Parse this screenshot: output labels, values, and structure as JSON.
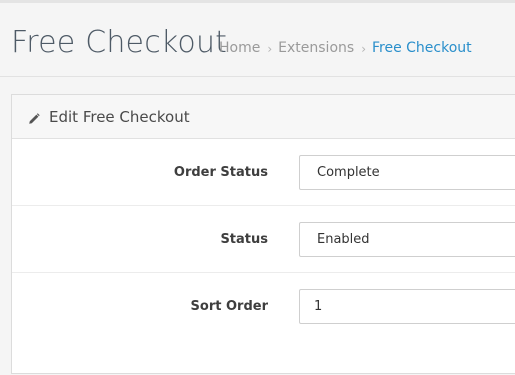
{
  "header": {
    "title": "Free Checkout",
    "breadcrumb": [
      {
        "label": "Home"
      },
      {
        "label": "Extensions"
      },
      {
        "label": "Free Checkout"
      }
    ],
    "separator": "›"
  },
  "panel": {
    "title": "Edit Free Checkout",
    "icon": "pencil-icon",
    "fields": [
      {
        "label": "Order Status",
        "value": "Complete",
        "type": "select"
      },
      {
        "label": "Status",
        "value": "Enabled",
        "type": "select"
      },
      {
        "label": "Sort Order",
        "value": "1",
        "type": "input"
      }
    ]
  },
  "colors": {
    "accent_link": "#2a8fcb",
    "title": "#4e5a66",
    "muted": "#9a9a9a"
  }
}
